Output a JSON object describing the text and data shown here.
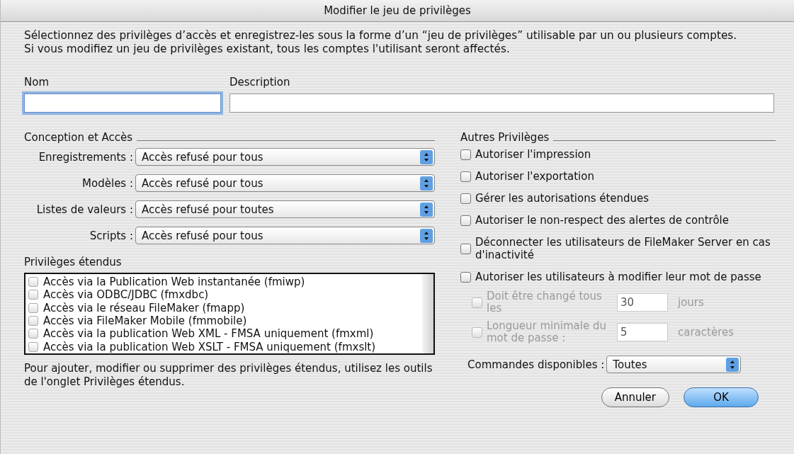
{
  "window": {
    "title": "Modifier le jeu de privilèges"
  },
  "intro": [
    "Sélectionnez des privilèges d’accès et enregistrez-les sous la forme d’un “jeu de privilèges” utilisable par un ou plusieurs comptes.",
    "Si vous modifiez un jeu de privilèges existant, tous les comptes l'utilisant seront affectés."
  ],
  "name_field": {
    "label": "Nom",
    "focused": true
  },
  "description_field": {
    "label": "Description"
  },
  "design_access": {
    "heading": "Conception et Accès",
    "popups": [
      {
        "label": "Enregistrements :",
        "value": "Accès refusé pour tous"
      },
      {
        "label": "Modèles :",
        "value": "Accès refusé pour tous"
      },
      {
        "label": "Listes de valeurs :",
        "value": "Accès refusé pour toutes"
      },
      {
        "label": "Scripts :",
        "value": "Accès refusé pour tous"
      }
    ]
  },
  "extended_privileges": {
    "heading": "Privilèges étendus",
    "items": [
      {
        "label": "Accès via la Publication Web instantanée (fmiwp)",
        "checked": false
      },
      {
        "label": "Accès via ODBC/JDBC (fmxdbc)",
        "checked": false
      },
      {
        "label": "Accès via le réseau FileMaker (fmapp)",
        "checked": false
      },
      {
        "label": "Accès via FileMaker Mobile (fmmobile)",
        "checked": false
      },
      {
        "label": "Accès via la publication Web XML - FMSA uniquement (fmxml)",
        "checked": false
      },
      {
        "label": "Accès via la publication Web XSLT - FMSA uniquement (fmxslt)",
        "checked": false
      }
    ],
    "note": "Pour ajouter, modifier ou supprimer des privilèges étendus, utilisez les outils de l'onglet Privilèges étendus."
  },
  "other_privileges": {
    "heading": "Autres Privilèges",
    "options": [
      {
        "label": "Autoriser l'impression",
        "checked": false
      },
      {
        "label": "Autoriser l'exportation",
        "checked": false
      },
      {
        "label": "Gérer les autorisations étendues",
        "checked": false
      },
      {
        "label": "Autoriser le non-respect des alertes de contrôle",
        "checked": false
      },
      {
        "label": "Déconnecter les utilisateurs de FileMaker Server en cas d'inactivité",
        "checked": false
      },
      {
        "label": "Autoriser les utilisateurs à modifier leur mot de passe",
        "checked": false
      }
    ],
    "password_options": [
      {
        "label": "Doit être changé tous les",
        "value": "30",
        "unit": "jours",
        "checked": false,
        "disabled": true
      },
      {
        "label": "Longueur minimale du mot de passe :",
        "value": "5",
        "unit": "caractères",
        "checked": false,
        "disabled": true
      }
    ],
    "commands": {
      "label": "Commandes disponibles :",
      "value": "Toutes"
    }
  },
  "buttons": [
    {
      "label": "Annuler",
      "kind": "cancel"
    },
    {
      "label": "OK",
      "kind": "default"
    }
  ]
}
